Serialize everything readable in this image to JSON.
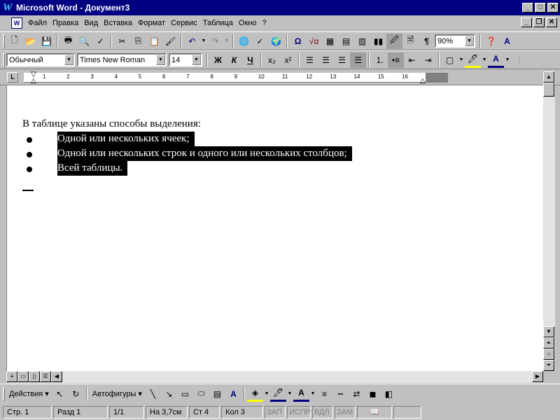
{
  "window": {
    "title": "Microsoft Word - Документ3",
    "logo": "W"
  },
  "menu": {
    "items": [
      "Файл",
      "Правка",
      "Вид",
      "Вставка",
      "Формат",
      "Сервис",
      "Таблица",
      "Окно",
      "?"
    ]
  },
  "standard_toolbar": {
    "zoom": "90%",
    "icons": [
      "new-icon",
      "open-icon",
      "save-icon",
      "print-icon",
      "print-preview-icon",
      "spelling-icon",
      "cut-icon",
      "copy-icon",
      "paste-icon",
      "format-painter-icon",
      "undo-icon",
      "redo-icon",
      "hyperlink-icon",
      "web-toolbar-icon",
      "tables-borders-icon",
      "insert-table-icon",
      "insert-excel-icon",
      "columns-icon",
      "drawing-icon",
      "document-map-icon",
      "show-hide-icon",
      "help-icon"
    ]
  },
  "formatting_toolbar": {
    "style": "Обычный",
    "font": "Times New Roman",
    "size": "14",
    "bold": "Ж",
    "italic": "К",
    "underline": "Ч"
  },
  "ruler": {
    "numbers": [
      "1",
      "2",
      "3",
      "4",
      "5",
      "6",
      "7",
      "8",
      "9",
      "10",
      "11",
      "12",
      "13",
      "14",
      "15",
      "16"
    ]
  },
  "document": {
    "intro": "В таблице указаны способы выделения:",
    "bullets": [
      "Одной или нескольких ячеек;",
      "Одной или нескольких строк и одного или нескольких столбцов;",
      "Всей таблицы."
    ]
  },
  "drawing_toolbar": {
    "actions": "Действия",
    "autoshapes": "Автофигуры"
  },
  "statusbar": {
    "page": "Стр. 1",
    "section": "Разд 1",
    "pages": "1/1",
    "at": "На 3,7см",
    "line": "Ст 4",
    "col": "Кол 3",
    "rec": "ЗАП",
    "trk": "ИСПР",
    "ext": "ВДЛ",
    "ovr": "ЗАМ"
  }
}
